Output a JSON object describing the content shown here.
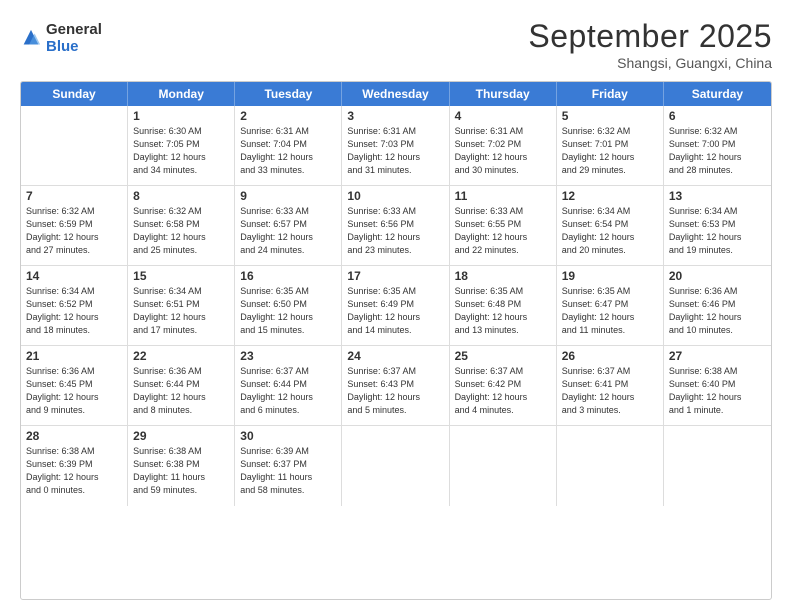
{
  "logo": {
    "general": "General",
    "blue": "Blue"
  },
  "header": {
    "month": "September 2025",
    "location": "Shangsi, Guangxi, China"
  },
  "days": [
    "Sunday",
    "Monday",
    "Tuesday",
    "Wednesday",
    "Thursday",
    "Friday",
    "Saturday"
  ],
  "weeks": [
    [
      {
        "day": "",
        "info": ""
      },
      {
        "day": "1",
        "info": "Sunrise: 6:30 AM\nSunset: 7:05 PM\nDaylight: 12 hours\nand 34 minutes."
      },
      {
        "day": "2",
        "info": "Sunrise: 6:31 AM\nSunset: 7:04 PM\nDaylight: 12 hours\nand 33 minutes."
      },
      {
        "day": "3",
        "info": "Sunrise: 6:31 AM\nSunset: 7:03 PM\nDaylight: 12 hours\nand 31 minutes."
      },
      {
        "day": "4",
        "info": "Sunrise: 6:31 AM\nSunset: 7:02 PM\nDaylight: 12 hours\nand 30 minutes."
      },
      {
        "day": "5",
        "info": "Sunrise: 6:32 AM\nSunset: 7:01 PM\nDaylight: 12 hours\nand 29 minutes."
      },
      {
        "day": "6",
        "info": "Sunrise: 6:32 AM\nSunset: 7:00 PM\nDaylight: 12 hours\nand 28 minutes."
      }
    ],
    [
      {
        "day": "7",
        "info": "Sunrise: 6:32 AM\nSunset: 6:59 PM\nDaylight: 12 hours\nand 27 minutes."
      },
      {
        "day": "8",
        "info": "Sunrise: 6:32 AM\nSunset: 6:58 PM\nDaylight: 12 hours\nand 25 minutes."
      },
      {
        "day": "9",
        "info": "Sunrise: 6:33 AM\nSunset: 6:57 PM\nDaylight: 12 hours\nand 24 minutes."
      },
      {
        "day": "10",
        "info": "Sunrise: 6:33 AM\nSunset: 6:56 PM\nDaylight: 12 hours\nand 23 minutes."
      },
      {
        "day": "11",
        "info": "Sunrise: 6:33 AM\nSunset: 6:55 PM\nDaylight: 12 hours\nand 22 minutes."
      },
      {
        "day": "12",
        "info": "Sunrise: 6:34 AM\nSunset: 6:54 PM\nDaylight: 12 hours\nand 20 minutes."
      },
      {
        "day": "13",
        "info": "Sunrise: 6:34 AM\nSunset: 6:53 PM\nDaylight: 12 hours\nand 19 minutes."
      }
    ],
    [
      {
        "day": "14",
        "info": "Sunrise: 6:34 AM\nSunset: 6:52 PM\nDaylight: 12 hours\nand 18 minutes."
      },
      {
        "day": "15",
        "info": "Sunrise: 6:34 AM\nSunset: 6:51 PM\nDaylight: 12 hours\nand 17 minutes."
      },
      {
        "day": "16",
        "info": "Sunrise: 6:35 AM\nSunset: 6:50 PM\nDaylight: 12 hours\nand 15 minutes."
      },
      {
        "day": "17",
        "info": "Sunrise: 6:35 AM\nSunset: 6:49 PM\nDaylight: 12 hours\nand 14 minutes."
      },
      {
        "day": "18",
        "info": "Sunrise: 6:35 AM\nSunset: 6:48 PM\nDaylight: 12 hours\nand 13 minutes."
      },
      {
        "day": "19",
        "info": "Sunrise: 6:35 AM\nSunset: 6:47 PM\nDaylight: 12 hours\nand 11 minutes."
      },
      {
        "day": "20",
        "info": "Sunrise: 6:36 AM\nSunset: 6:46 PM\nDaylight: 12 hours\nand 10 minutes."
      }
    ],
    [
      {
        "day": "21",
        "info": "Sunrise: 6:36 AM\nSunset: 6:45 PM\nDaylight: 12 hours\nand 9 minutes."
      },
      {
        "day": "22",
        "info": "Sunrise: 6:36 AM\nSunset: 6:44 PM\nDaylight: 12 hours\nand 8 minutes."
      },
      {
        "day": "23",
        "info": "Sunrise: 6:37 AM\nSunset: 6:44 PM\nDaylight: 12 hours\nand 6 minutes."
      },
      {
        "day": "24",
        "info": "Sunrise: 6:37 AM\nSunset: 6:43 PM\nDaylight: 12 hours\nand 5 minutes."
      },
      {
        "day": "25",
        "info": "Sunrise: 6:37 AM\nSunset: 6:42 PM\nDaylight: 12 hours\nand 4 minutes."
      },
      {
        "day": "26",
        "info": "Sunrise: 6:37 AM\nSunset: 6:41 PM\nDaylight: 12 hours\nand 3 minutes."
      },
      {
        "day": "27",
        "info": "Sunrise: 6:38 AM\nSunset: 6:40 PM\nDaylight: 12 hours\nand 1 minute."
      }
    ],
    [
      {
        "day": "28",
        "info": "Sunrise: 6:38 AM\nSunset: 6:39 PM\nDaylight: 12 hours\nand 0 minutes."
      },
      {
        "day": "29",
        "info": "Sunrise: 6:38 AM\nSunset: 6:38 PM\nDaylight: 11 hours\nand 59 minutes."
      },
      {
        "day": "30",
        "info": "Sunrise: 6:39 AM\nSunset: 6:37 PM\nDaylight: 11 hours\nand 58 minutes."
      },
      {
        "day": "",
        "info": ""
      },
      {
        "day": "",
        "info": ""
      },
      {
        "day": "",
        "info": ""
      },
      {
        "day": "",
        "info": ""
      }
    ]
  ]
}
